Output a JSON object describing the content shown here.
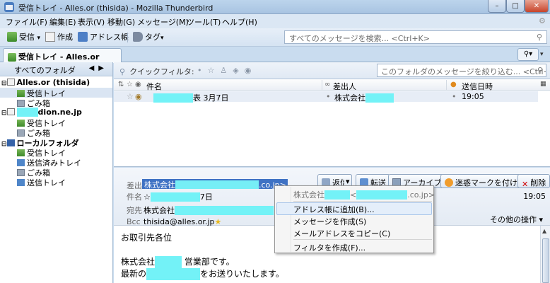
{
  "window": {
    "title": "受信トレイ - Alles.or (thisida) - Mozilla Thunderbird",
    "minimize": "–",
    "maximize": "□",
    "close": "✕"
  },
  "menubar": {
    "items": [
      "ファイル(F)",
      "編集(E)",
      "表示(V)",
      "移動(G)",
      "メッセージ(M)",
      "ツール(T)",
      "ヘルプ(H)"
    ],
    "gear": "⚙"
  },
  "toolbar": {
    "get_label": "受信",
    "get_arrow": "▾",
    "write_label": "作成",
    "addressbook_label": "アドレス帳",
    "tag_label": "タグ",
    "tag_arrow": "▾",
    "search_placeholder": "すべてのメッセージを検索... <Ctrl+K>",
    "search_icon": "⚲"
  },
  "tabs": {
    "active_tab": "受信トレイ - Alles.or (thisida)",
    "tools_label": "⚲▾",
    "overflow": "▾"
  },
  "folderpane": {
    "header": "すべてのフォルダ",
    "nav_prev": "◀",
    "nav_next": "▶",
    "account1": "Alles.or (thisida)",
    "account1_inbox": "受信トレイ",
    "account1_trash": "ごみ箱",
    "account2_suffix": "dion.ne.jp",
    "account2_inbox": "受信トレイ",
    "account2_trash": "ごみ箱",
    "local": "ローカルフォルダ",
    "local_inbox": "受信トレイ",
    "local_sent": "送信済みトレイ",
    "local_trash": "ごみ箱",
    "local_outbox": "送信トレイ"
  },
  "quickfilter": {
    "label": "クイックフィルタ:",
    "search_placeholder": "このフォルダのメッセージを絞り込む... <Ctrl+F>",
    "search_icon": "⚲"
  },
  "threadpane": {
    "col_subject": "件名",
    "col_sender": "差出人",
    "col_date": "送信日時",
    "row_subject_suffix": "表 3月7日",
    "row_sender_prefix": "株式会社",
    "row_date": "19:05"
  },
  "message": {
    "from_label": "差出人",
    "from_value_prefix": "株式会社",
    "from_value_suffix": ".co.jp>",
    "subject_label": "件名",
    "subject_value_prefix": "☆",
    "subject_value_suffix": "7日",
    "to_label": "宛先",
    "to_value_prefix": "株式会社",
    "bcc_label": "Bcc",
    "bcc_value": "thisida@alles.or.jp",
    "time": "19:05",
    "other_actions": "その他の操作 ▾",
    "buttons": {
      "reply": "返信",
      "reply_arrow": "▾",
      "forward": "転送",
      "archive": "アーカイブ",
      "junk": "迷惑マークを付ける",
      "delete": "削除",
      "delete_icon": "✕"
    },
    "body": {
      "line1": "お取引先各位",
      "line2_prefix": "株式会社",
      "line2_suffix": "営業部です。",
      "line3_prefix": "最新の",
      "line3_suffix": "をお送りいたします。"
    }
  },
  "context_menu": {
    "header_prefix": "株式会社",
    "header_mid": "<",
    "header_suffix": ".co.jp>",
    "items": [
      "アドレス帳に追加(B)...",
      "メッセージを作成(S)",
      "メールアドレスをコピー(C)",
      "フィルタを作成(F)..."
    ]
  }
}
